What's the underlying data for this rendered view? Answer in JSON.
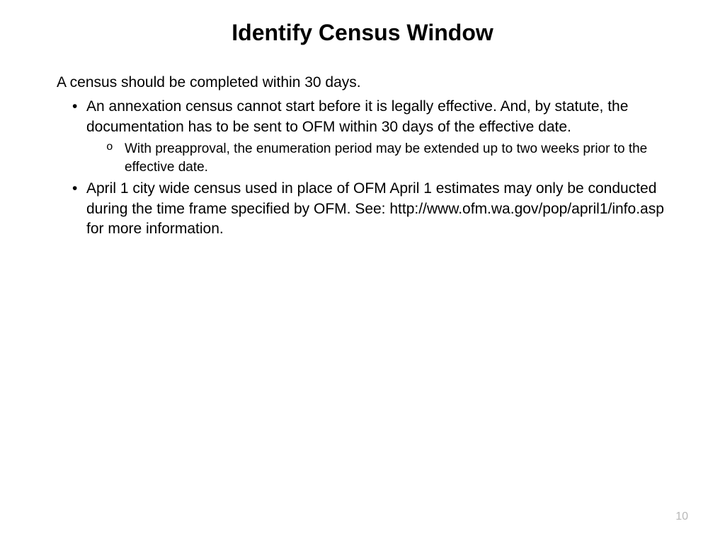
{
  "title": "Identify Census Window",
  "intro": "A census should be completed within 30 days.",
  "bullets": {
    "b1": "An annexation census cannot start before it is legally effective.  And, by statute, the documentation has to be sent to OFM within 30 days of the effective date.",
    "b1_sub1": "With preapproval, the enumeration period may be extended up to two weeks prior to the effective date.",
    "b2": "April 1 city wide census used in place of OFM April 1 estimates may only be conducted during the time frame specified by OFM.  See: http://www.ofm.wa.gov/pop/april1/info.asp for more information."
  },
  "page_number": "10"
}
